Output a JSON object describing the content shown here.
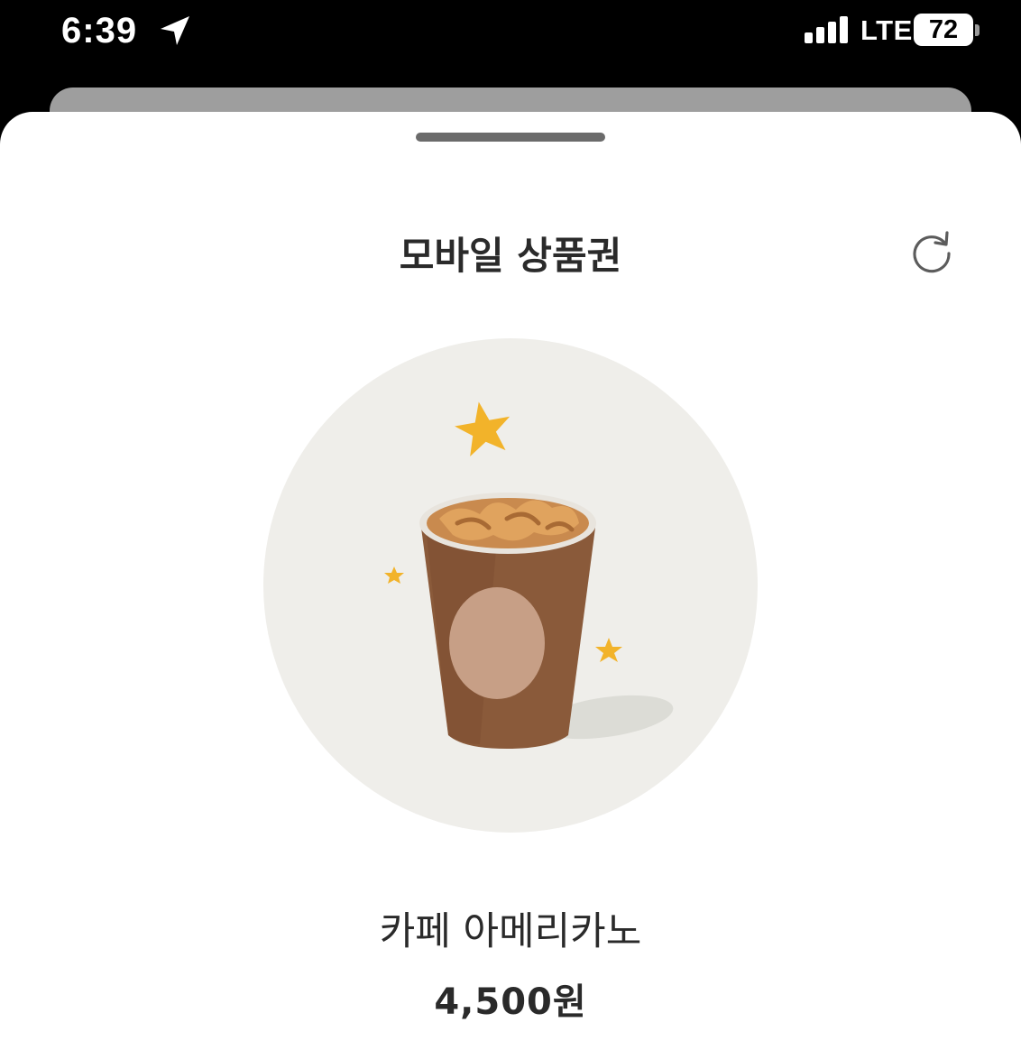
{
  "status_bar": {
    "time": "6:39",
    "location_icon": "location-arrow-icon",
    "signal_icon": "cellular-signal-icon",
    "network": "LTE",
    "battery_level": "72"
  },
  "sheet": {
    "title": "모바일 상품권",
    "refresh_icon": "refresh-icon"
  },
  "product": {
    "image_icon": "iced-americano-cup-icon",
    "name": "카페 아메리카노",
    "price": "4,500원"
  },
  "colors": {
    "status_bar_bg": "#000000",
    "sheet_bg": "#ffffff",
    "circle_bg": "#efeeea",
    "coffee": "#8a5a3a",
    "star": "#f2b32a",
    "text": "#2a2a2a"
  }
}
